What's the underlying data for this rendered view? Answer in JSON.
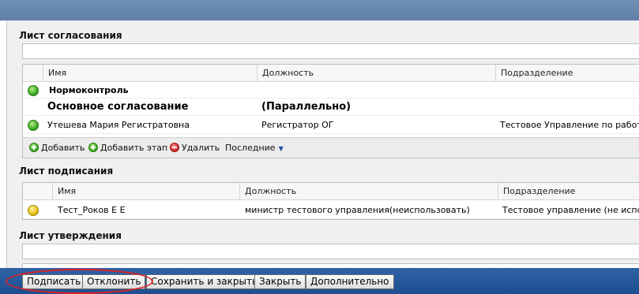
{
  "approval": {
    "title": "Лист согласования",
    "columns": [
      "Имя",
      "Должность",
      "Подразделение"
    ],
    "group1": "Нормоконтроль",
    "group2": {
      "name": "Основное согласование",
      "mode": "(Параллельно)"
    },
    "rows": [
      {
        "name": "Утешева Мария Регистратовна",
        "position": "Регистратор ОГ",
        "department": "Тестовое Управление по работе с",
        "status": "green"
      }
    ],
    "toolbar": {
      "add": "Добавить",
      "add_stage": "Добавить этап",
      "delete": "Удалить",
      "recent": "Последние"
    }
  },
  "signing": {
    "title": "Лист подписания",
    "columns": [
      "Имя",
      "Должность",
      "Подразделение"
    ],
    "rows": [
      {
        "name": "Тест_Роков Е Е",
        "position": "министр тестового управления(неиспользовать)",
        "department": "Тестовое управление (не исполь:",
        "status": "yellow"
      }
    ]
  },
  "approval_final": {
    "title": "Лист утверждения"
  },
  "footer": {
    "sign": "Подписать",
    "reject": "Отклонить",
    "save_close": "Сохранить и закрыть",
    "close": "Закрыть",
    "more": "Дополнительно"
  },
  "colors": {
    "footer": "#1d4e8f",
    "highlight": "#dd2222",
    "topbar": "#6f8fb4"
  }
}
